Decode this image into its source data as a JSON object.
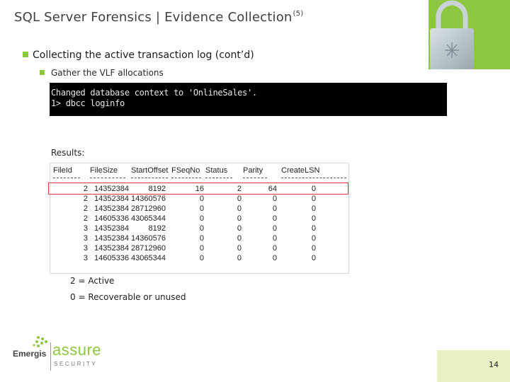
{
  "slide": {
    "title": "SQL Server Forensics | Evidence Collection",
    "title_sup": "(5)",
    "bullet1": "Collecting the active transaction log (cont’d)",
    "bullet2": "Gather the VLF allocations",
    "console_lines": [
      "Changed database context to 'OnlineSales'.",
      "1> dbcc loginfo"
    ],
    "results_label": "Results:",
    "legend_active": "2 = Active",
    "legend_recoverable": "0 = Recoverable or unused",
    "page_number": "14"
  },
  "results_table": {
    "columns": [
      "FileId",
      "FileSize",
      "StartOffset",
      "FSeqNo",
      "Status",
      "Parity",
      "CreateLSN"
    ],
    "rows": [
      [
        "2",
        "14352384",
        "8192",
        "16",
        "2",
        "64",
        "0"
      ],
      [
        "2",
        "14352384",
        "14360576",
        "0",
        "0",
        "0",
        "0"
      ],
      [
        "2",
        "14352384",
        "28712960",
        "0",
        "0",
        "0",
        "0"
      ],
      [
        "2",
        "14605336",
        "43065344",
        "0",
        "0",
        "0",
        "0"
      ],
      [
        "3",
        "14352384",
        "8192",
        "0",
        "0",
        "0",
        "0"
      ],
      [
        "3",
        "14352384",
        "14360576",
        "0",
        "0",
        "0",
        "0"
      ],
      [
        "3",
        "14352384",
        "28712960",
        "0",
        "0",
        "0",
        "0"
      ],
      [
        "3",
        "14605336",
        "43065344",
        "0",
        "0",
        "0",
        "0"
      ]
    ],
    "highlighted_row": 0
  },
  "branding": {
    "company": "Emergis",
    "product": "assure",
    "product_sub": "SECURITY"
  },
  "colors": {
    "accent_green": "#8dc63f",
    "page_box": "#e8f1c3",
    "highlight_red": "#e23a3a"
  },
  "icons": {
    "header_graphic": "padlock-icon",
    "logo_mark": "emergis-logo-icon"
  }
}
